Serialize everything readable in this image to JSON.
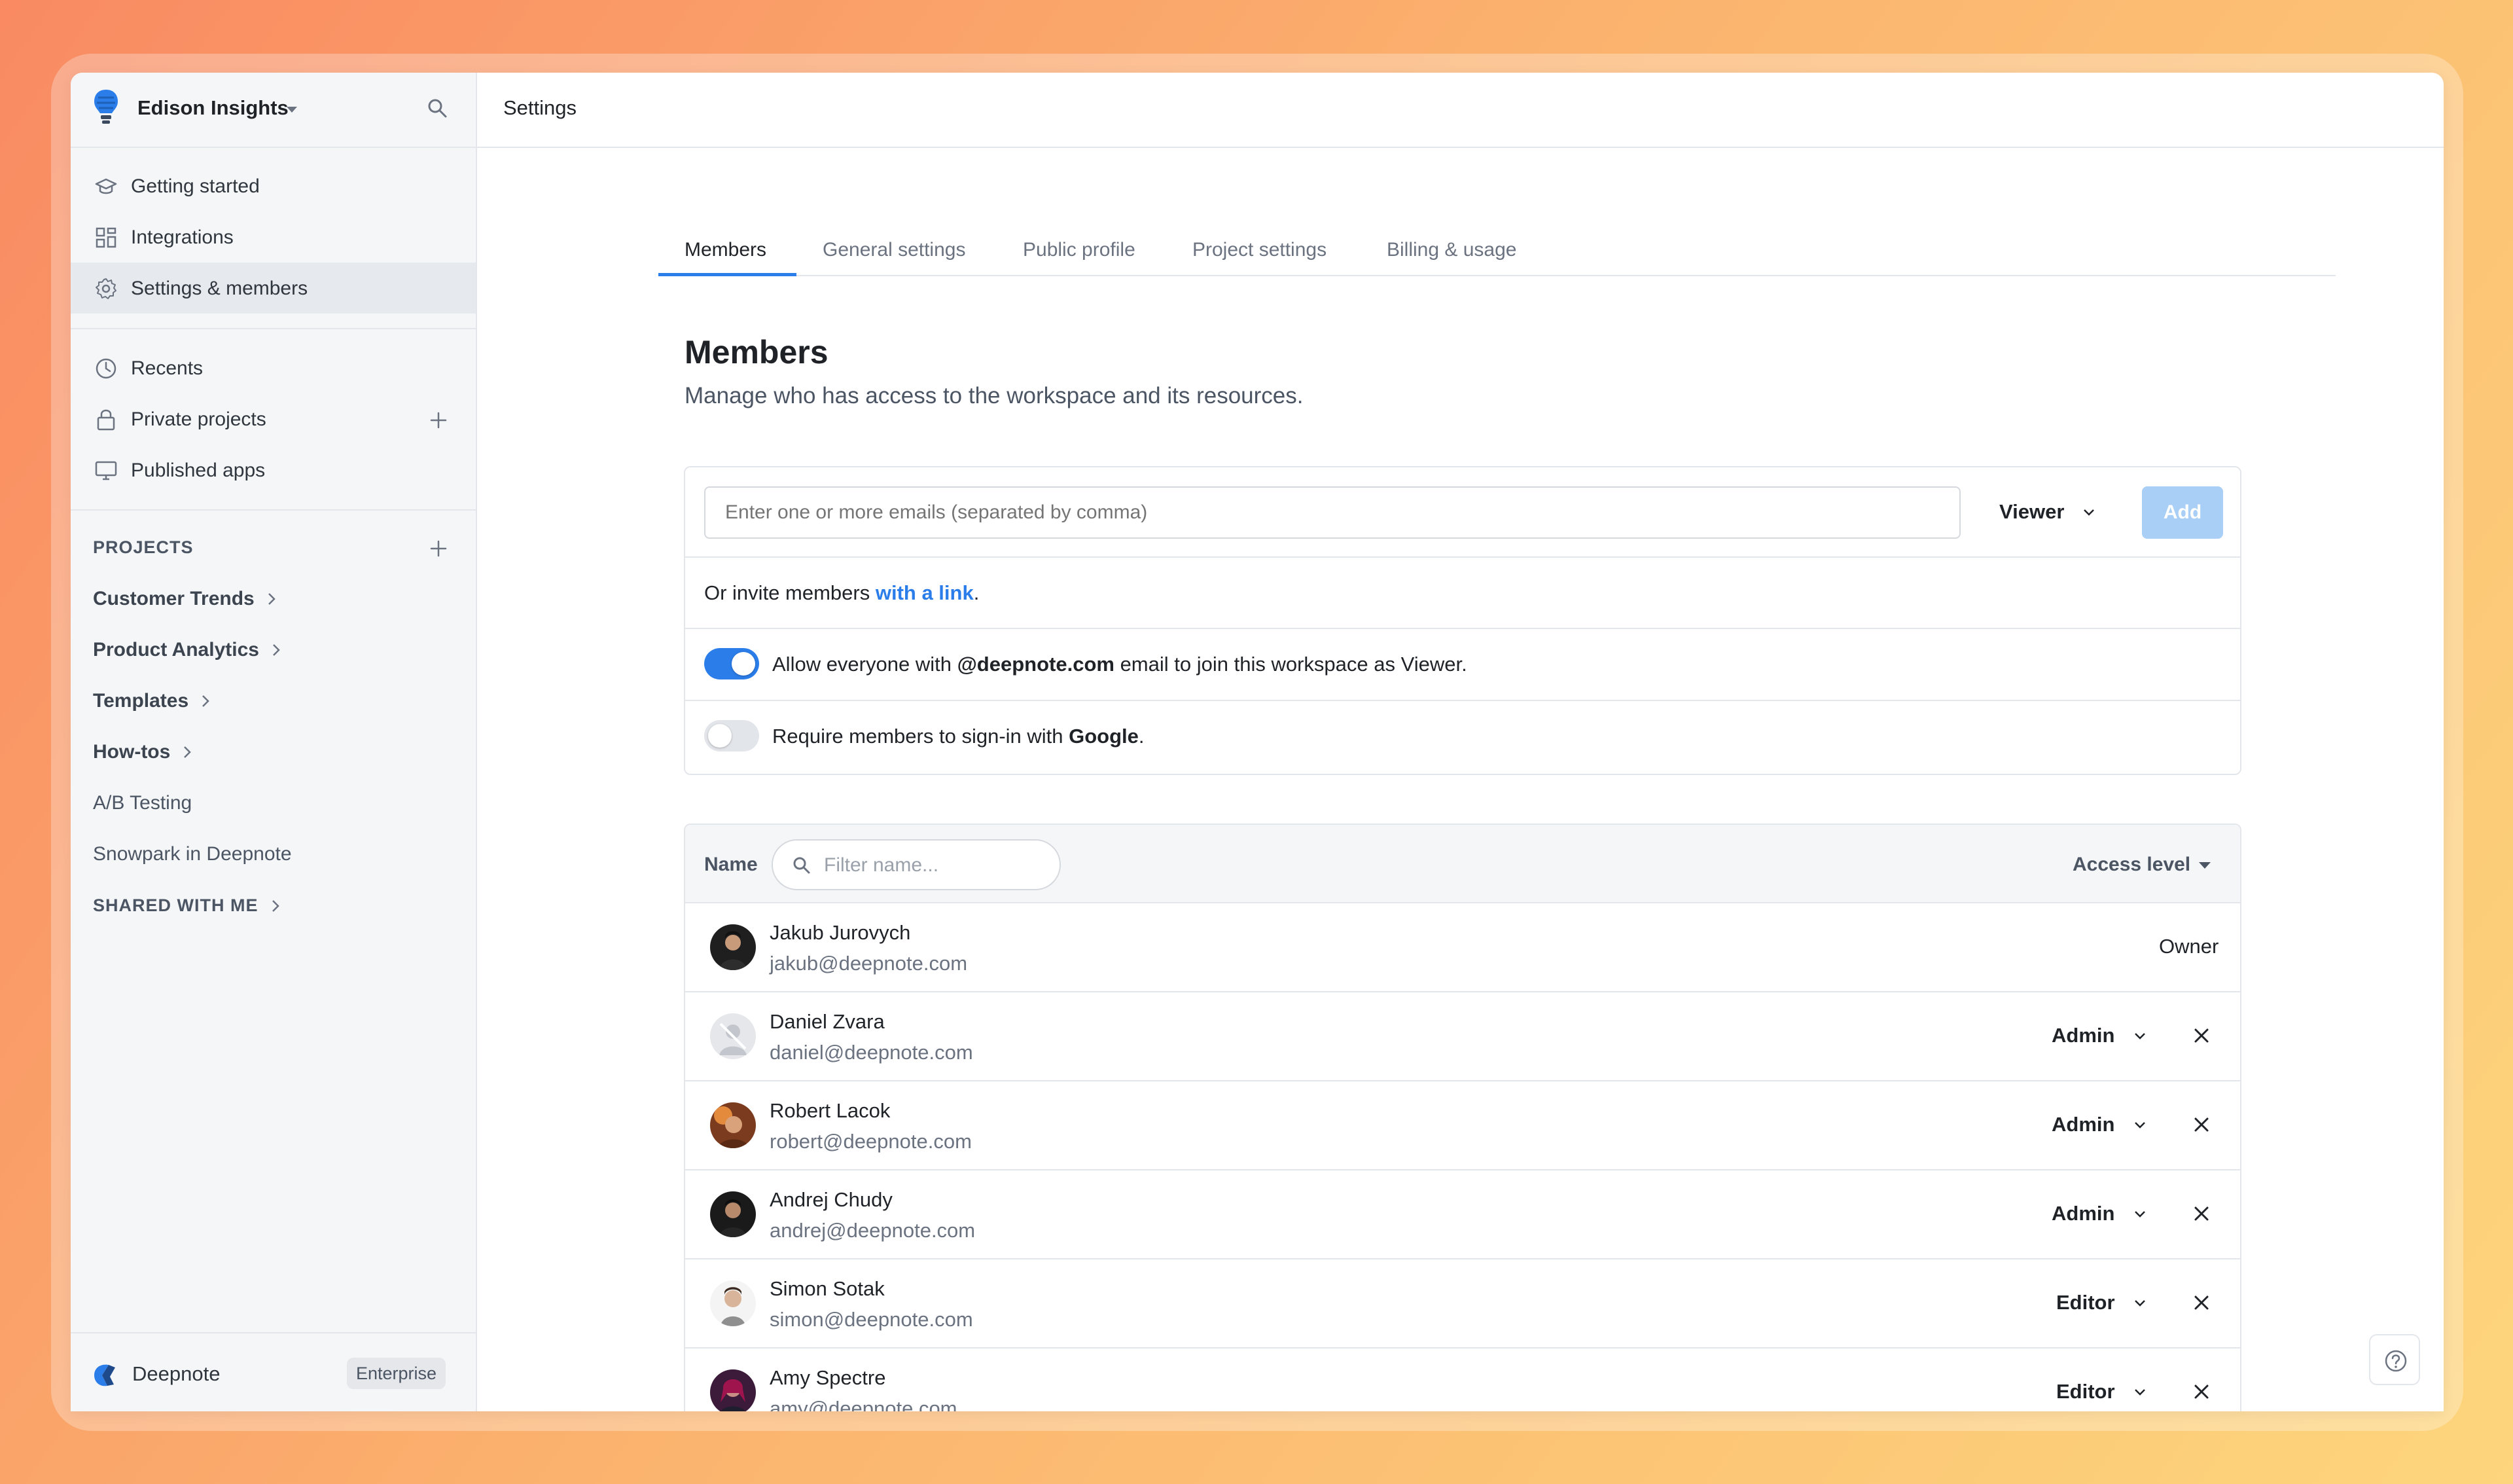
{
  "workspace": {
    "name": "Edison Insights"
  },
  "sidebar": {
    "nav": [
      {
        "label": "Getting started",
        "icon": "graduation-cap-icon"
      },
      {
        "label": "Integrations",
        "icon": "grid-icon"
      },
      {
        "label": "Settings & members",
        "icon": "gear-icon",
        "active": true
      },
      {
        "label": "Recents",
        "icon": "clock-icon"
      },
      {
        "label": "Private projects",
        "icon": "lock-icon"
      },
      {
        "label": "Published apps",
        "icon": "monitor-icon"
      }
    ],
    "projects_title": "PROJECTS",
    "projects": [
      {
        "label": "Customer Trends"
      },
      {
        "label": "Product Analytics"
      },
      {
        "label": "Templates"
      },
      {
        "label": "How-tos"
      },
      {
        "label": "A/B Testing"
      },
      {
        "label": "Snowpark in Deepnote"
      }
    ],
    "shared_title": "SHARED WITH ME",
    "footer": {
      "name": "Deepnote",
      "badge": "Enterprise"
    }
  },
  "topbar": {
    "title": "Settings"
  },
  "tabs": [
    {
      "label": "Members",
      "active": true
    },
    {
      "label": "General settings"
    },
    {
      "label": "Public profile"
    },
    {
      "label": "Project settings"
    },
    {
      "label": "Billing & usage"
    }
  ],
  "page": {
    "title": "Members",
    "subtitle": "Manage who has access to the workspace and its resources."
  },
  "invite": {
    "placeholder": "Enter one or more emails (separated by comma)",
    "role": "Viewer",
    "add_label": "Add",
    "link_prefix": "Or invite members ",
    "link_text": "with a link",
    "link_suffix": ".",
    "toggle1": {
      "on": true,
      "pre": "Allow everyone with ",
      "bold": "@deepnote.com",
      "post": " email to join this workspace as Viewer."
    },
    "toggle2": {
      "on": false,
      "pre": "Require members to sign-in with ",
      "bold": "Google",
      "post": "."
    }
  },
  "table": {
    "name_header": "Name",
    "filter_placeholder": "Filter name...",
    "access_header": "Access level",
    "members": [
      {
        "name": "Jakub Jurovych",
        "email": "jakub@deepnote.com",
        "role": "Owner"
      },
      {
        "name": "Daniel Zvara",
        "email": "daniel@deepnote.com",
        "role": "Admin"
      },
      {
        "name": "Robert Lacok",
        "email": "robert@deepnote.com",
        "role": "Admin"
      },
      {
        "name": "Andrej Chudy",
        "email": "andrej@deepnote.com",
        "role": "Admin"
      },
      {
        "name": "Simon Sotak",
        "email": "simon@deepnote.com",
        "role": "Editor"
      },
      {
        "name": "Amy Spectre",
        "email": "amy@deepnote.com",
        "role": "Editor"
      }
    ]
  },
  "colors": {
    "accent": "#2b7de9",
    "add_disabled": "#a9cff6"
  }
}
